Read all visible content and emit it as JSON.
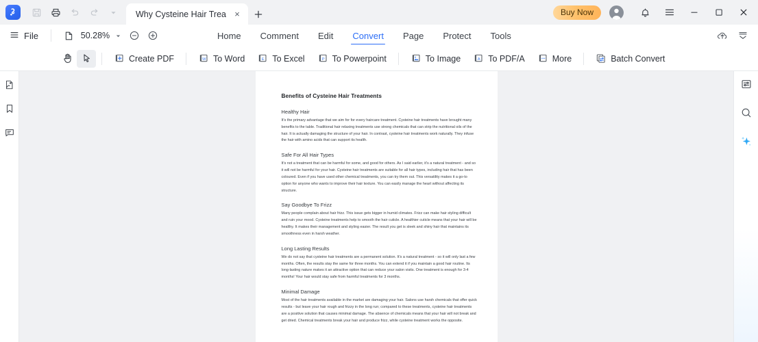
{
  "app": {
    "logo_icon": "pdfelement-logo-icon",
    "brand_color": "#2f6bf3"
  },
  "titlebar": {
    "quick_actions": [
      {
        "name": "save-icon",
        "label": "Save",
        "disabled": true
      },
      {
        "name": "print-icon",
        "label": "Print",
        "disabled": false
      },
      {
        "name": "undo-icon",
        "label": "Undo",
        "disabled": true
      },
      {
        "name": "redo-icon",
        "label": "Redo",
        "disabled": true
      },
      {
        "name": "chevron-down-icon",
        "label": "More",
        "disabled": true
      }
    ],
    "tab": {
      "title": "Why Cysteine Hair Treat...",
      "close_label": "×"
    },
    "new_tab_label": "+",
    "buy_now_label": "Buy Now",
    "buy_now_color": "#ffc16b",
    "account_icon": "account-avatar-icon",
    "notification_icon": "bell-icon",
    "menu_icon": "hamburger-menu-icon",
    "minimize_label": "—",
    "maximize_label": "□",
    "close_label": "×"
  },
  "menubar": {
    "file_label": "File",
    "file_icon": "hamburger-menu-icon",
    "page_fit_icon": "page-fit-icon",
    "zoom_value": "50.28%",
    "zoom_dropdown_icon": "chevron-down-icon",
    "zoom_out_icon": "zoom-out-icon",
    "zoom_in_icon": "zoom-in-icon",
    "tabs": [
      {
        "label": "Home",
        "active": false
      },
      {
        "label": "Comment",
        "active": false
      },
      {
        "label": "Edit",
        "active": false
      },
      {
        "label": "Convert",
        "active": true
      },
      {
        "label": "Page",
        "active": false
      },
      {
        "label": "Protect",
        "active": false
      },
      {
        "label": "Tools",
        "active": false
      }
    ],
    "active_tab": "Convert",
    "active_color": "#2b6df6",
    "right_icons": [
      {
        "name": "cloud-upload-icon",
        "label": "Cloud Upload"
      },
      {
        "name": "collapse-ribbon-icon",
        "label": "Collapse Ribbon"
      }
    ]
  },
  "toolbar": {
    "items": [
      {
        "label": "",
        "icon": "hand-tool-icon",
        "icon_only": true,
        "selected": false,
        "sep_after": false
      },
      {
        "label": "",
        "icon": "select-cursor-icon",
        "icon_only": true,
        "selected": true,
        "sep_after": true
      },
      {
        "label": "Create PDF",
        "icon": "create-pdf-icon",
        "icon_only": false,
        "selected": false,
        "sep_after": true
      },
      {
        "label": "To Word",
        "icon": "to-word-icon",
        "icon_only": false,
        "selected": false,
        "sep_after": false
      },
      {
        "label": "To Excel",
        "icon": "to-excel-icon",
        "icon_only": false,
        "selected": false,
        "sep_after": false
      },
      {
        "label": "To Powerpoint",
        "icon": "to-powerpoint-icon",
        "icon_only": false,
        "selected": false,
        "sep_after": true
      },
      {
        "label": "To Image",
        "icon": "to-image-icon",
        "icon_only": false,
        "selected": false,
        "sep_after": false
      },
      {
        "label": "To PDF/A",
        "icon": "to-pdfa-icon",
        "icon_only": false,
        "selected": false,
        "sep_after": false
      },
      {
        "label": "More",
        "icon": "more-convert-icon",
        "icon_only": false,
        "selected": false,
        "sep_after": true
      },
      {
        "label": "Batch Convert",
        "icon": "batch-convert-icon",
        "icon_only": false,
        "selected": false,
        "sep_after": false
      }
    ]
  },
  "left_rail": {
    "items": [
      {
        "name": "thumbnails-panel-icon",
        "label": "Thumbnails"
      },
      {
        "name": "bookmark-panel-icon",
        "label": "Bookmarks"
      },
      {
        "name": "comments-panel-icon",
        "label": "Comments"
      }
    ]
  },
  "right_rail": {
    "items": [
      {
        "name": "properties-panel-icon",
        "label": "Properties"
      },
      {
        "name": "search-icon",
        "label": "Search"
      },
      {
        "name": "ai-sparkle-icon",
        "label": "AI Assistant"
      }
    ]
  },
  "document": {
    "title": "Benefits of Cysteine Hair Treatments",
    "sections": [
      {
        "heading": "Healthy Hair",
        "body": "It's the primary advantage that we aim for for every haircare treatment. Cysteine hair treatments have brought many benefits to the table. Traditional hair relaxing treatments use strong chemicals that can strip the nutritional oils of the hair. It is actually damaging the structure of your hair. In contrast, cysteine hair treatments work naturally. They infuse the hair with amino acids that can support its health."
      },
      {
        "heading": "Safe For All Hair Types",
        "body": "It's not a treatment that can be harmful for some, and good for others. As I said earlier, it's a natural treatment - and so it will not be harmful for your hair. Cysteine hair treatments are suitable for all hair types, including hair that has been coloured. Even if you have used other chemical treatments, you can try them out. This versatility makes it a go-to option for anyone who wants to improve their hair texture. You can easily manage the heart without affecting its structure."
      },
      {
        "heading": "Say Goodbye To Frizz",
        "body": "Many people complain about hair frizz. This issue gets bigger in humid climates. Frizz can make hair styling difficult and ruin your mood. Cysteine treatments help to smooth the hair cuticle. A healthier cuticle means that your hair will be healthy. It makes their management and styling easier. The result you get is sleek and shiny hair that maintains its smoothness even in harsh weather."
      },
      {
        "heading": "Long Lasting Results",
        "body": "We do not say that cysteine hair treatments are a permanent solution. It's a natural treatment - so it will only last a few months. Often, the results stay the same for three months. You can extend it if you maintain a good hair routine. Its long-lasting nature makes it an attractive option that can reduce your salon visits. One treatment is enough for 3-4 months! Your hair would stay safe from harmful treatments for 3 months."
      },
      {
        "heading": "Minimal Damage",
        "body": "Most of the hair treatments available in the market are damaging your hair. Salons use harsh chemicals that offer quick results - but leave your hair rough and frizzy in the long run; compared to these treatments, cysteine hair treatments are a positive solution that causes minimal damage. The absence of chemicals means that your hair will not break and get dried. Chemical treatments break your hair and produce frizz, while cysteine treatment works the opposite."
      }
    ]
  }
}
